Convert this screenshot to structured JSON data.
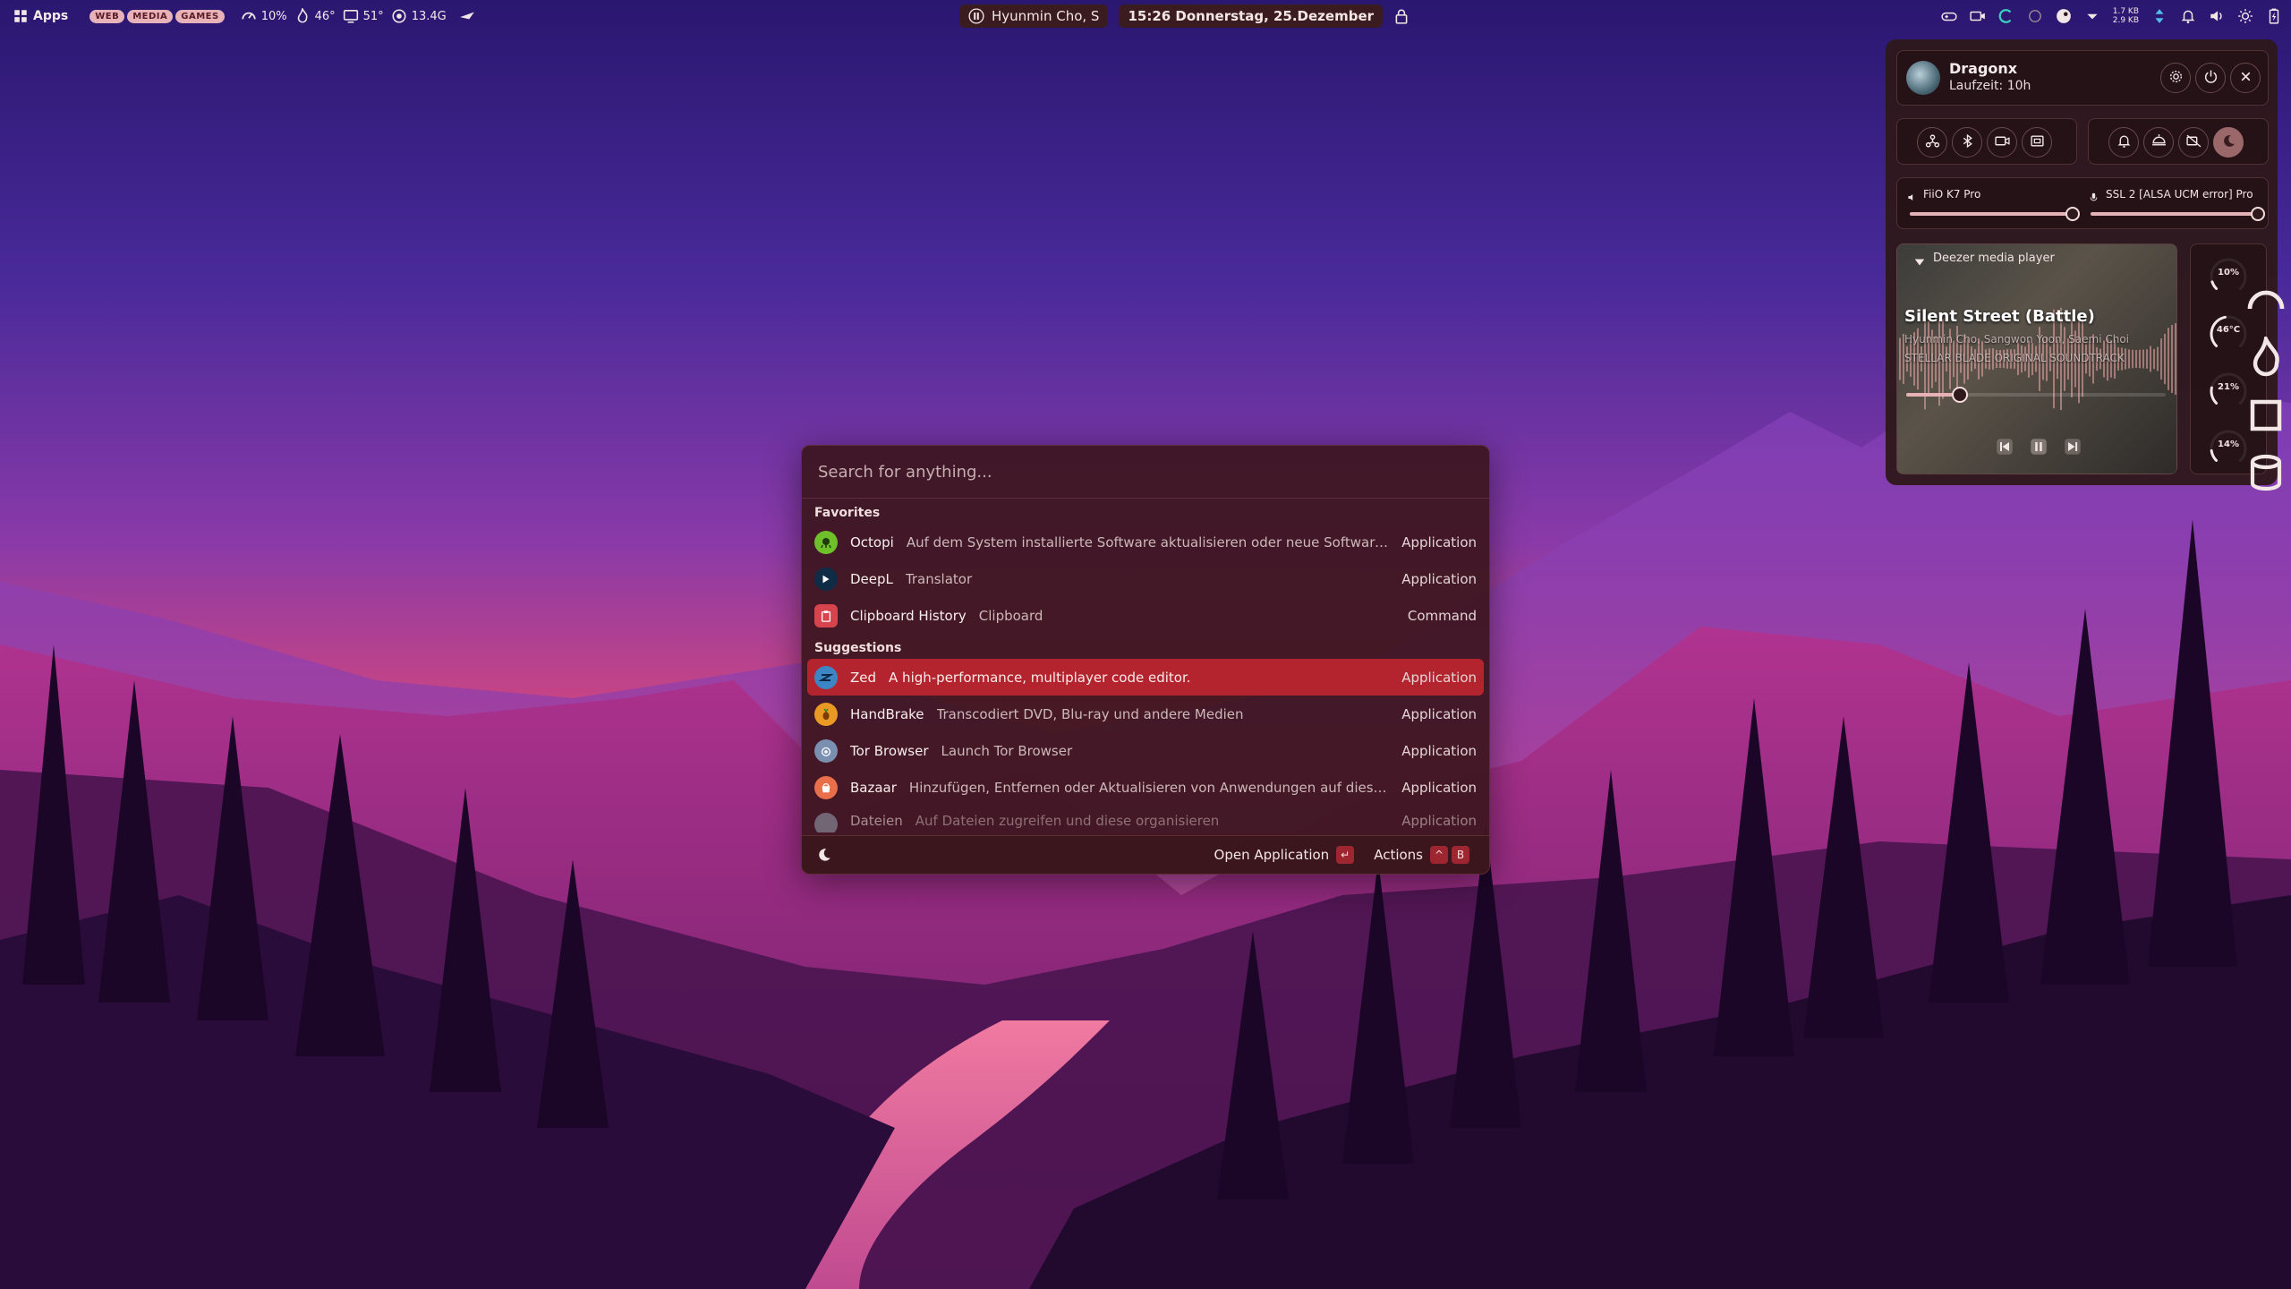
{
  "topbar": {
    "apps_label": "Apps",
    "workspaces": [
      "WEB",
      "MEDIA",
      "GAMES"
    ],
    "stats": [
      {
        "icon": "gauge-icon",
        "value": "10%"
      },
      {
        "icon": "flame-icon",
        "value": "46°"
      },
      {
        "icon": "monitor-icon",
        "value": "51°"
      },
      {
        "icon": "memory-icon",
        "value": "13.4G"
      }
    ],
    "now_playing": "Hyunmin Cho, S",
    "clock": "15:26 Donnerstag, 25.Dezember",
    "net_up": "1.7 KB",
    "net_down": "2.9 KB"
  },
  "launcher": {
    "placeholder": "Search for anything...",
    "favorites_title": "Favorites",
    "favorites": [
      {
        "title": "Octopi",
        "subtitle": "Auf dem System installierte Software aktualisieren oder neue Software hinz...",
        "kind": "Application",
        "icon": "octopus-icon",
        "color": "#6fbf2a"
      },
      {
        "title": "DeepL",
        "subtitle": "Translator",
        "kind": "Application",
        "icon": "deepl-icon",
        "color": "#0f2b46"
      },
      {
        "title": "Clipboard History",
        "subtitle": "Clipboard",
        "kind": "Command",
        "icon": "clipboard-icon",
        "color": "#d8444e"
      }
    ],
    "suggestions_title": "Suggestions",
    "suggestions": [
      {
        "title": "Zed",
        "subtitle": "A high-performance, multiplayer code editor.",
        "kind": "Application",
        "icon": "zed-icon",
        "color": "#3c86c6",
        "selected": true
      },
      {
        "title": "HandBrake",
        "subtitle": "Transcodiert DVD, Blu-ray und andere Medien",
        "kind": "Application",
        "icon": "pineapple-icon",
        "color": "#e89a24"
      },
      {
        "title": "Tor Browser",
        "subtitle": "Launch Tor Browser",
        "kind": "Application",
        "icon": "tor-icon",
        "color": "#7b8fb0"
      },
      {
        "title": "Bazaar",
        "subtitle": "Hinzufügen, Entfernen oder Aktualisieren von Anwendungen auf diesem C...",
        "kind": "Application",
        "icon": "bazaar-icon",
        "color": "#e86f4a"
      },
      {
        "title": "Dateien",
        "subtitle": "Auf Dateien zugreifen und diese organisieren",
        "kind": "Application",
        "icon": "folder-icon",
        "color": "#9aa6b5"
      }
    ],
    "footer": {
      "open_label": "Open Application",
      "open_key": "↵",
      "actions_label": "Actions",
      "actions_keys": [
        "^",
        "B"
      ]
    }
  },
  "panel": {
    "user": {
      "name": "Dragonx",
      "uptime": "Laufzeit: 10h"
    },
    "toggles_left": [
      "network-icon",
      "bluetooth-icon",
      "camera-icon",
      "screenshot-icon"
    ],
    "toggles_right": [
      "bell-icon",
      "brightness-icon",
      "camera-off-icon",
      "moon-icon"
    ],
    "audio": {
      "output": {
        "label": "FiiO K7 Pro",
        "level": 0.95
      },
      "input": {
        "label": "SSL 2 [ALSA UCM error] Pro",
        "level": 0.98
      }
    },
    "media": {
      "player": "Deezer media player",
      "title": "Silent Street (Battle)",
      "artist": "Hyunmin Cho, Sangwon Yoon, Saemi Choi",
      "album": "STELLAR BLADE ORIGINAL SOUNDTRACK",
      "progress": 0.2
    },
    "gauges": [
      {
        "value": "10%",
        "icon": "gauge-icon",
        "level": 0.1
      },
      {
        "value": "46°C",
        "icon": "flame-icon",
        "level": 0.46
      },
      {
        "value": "21%",
        "icon": "cpu-icon",
        "level": 0.21
      },
      {
        "value": "14%",
        "icon": "disk-icon",
        "level": 0.14
      }
    ]
  },
  "colors": {
    "accent": "#b4242e",
    "panel_bg": "#2e181a",
    "launcher_bg": "#3c161e",
    "pill": "#e7b3b8"
  }
}
